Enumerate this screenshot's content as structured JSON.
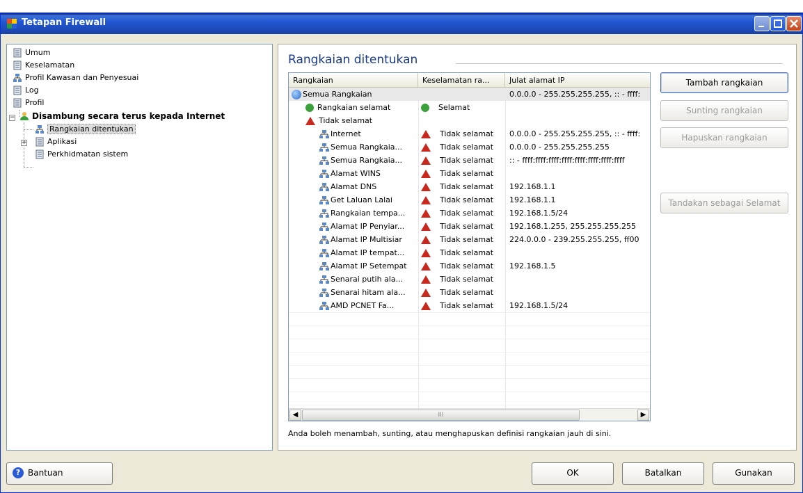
{
  "window": {
    "title": "Tetapan Firewall"
  },
  "tree": {
    "items": [
      {
        "label": "Umum",
        "icon": "document-list-icon"
      },
      {
        "label": "Keselamatan",
        "icon": "document-list-icon"
      },
      {
        "label": "Profil Kawasan dan Penyesuai",
        "icon": "network-icon"
      },
      {
        "label": "Log",
        "icon": "document-list-icon"
      },
      {
        "label": "Profil",
        "icon": "document-list-icon"
      },
      {
        "label": "Disambung secara terus kepada Internet",
        "icon": "user-profile-icon"
      },
      {
        "label": "Rangkaian ditentukan",
        "icon": "network-icon"
      },
      {
        "label": "Aplikasi",
        "icon": "document-list-icon"
      },
      {
        "label": "Perkhidmatan sistem",
        "icon": "document-list-icon"
      }
    ]
  },
  "main": {
    "section_title": "Rangkaian ditentukan",
    "columns": [
      "Rangkaian",
      "Keselamatan ra...",
      "Julat alamat IP"
    ],
    "rows": [
      {
        "name": "Semua Rangkaian",
        "security": "",
        "ip": "0.0.0.0 - 255.255.255.255, :: - ffff:"
      },
      {
        "name": "Rangkaian selamat",
        "security": "Selamat",
        "ip": ""
      },
      {
        "name": "Tidak selamat",
        "security": "",
        "ip": ""
      },
      {
        "name": "Internet",
        "security": "Tidak selamat",
        "ip": "0.0.0.0 - 255.255.255.255, :: - ffff:"
      },
      {
        "name": "Semua Rangkaia...",
        "security": "Tidak selamat",
        "ip": "0.0.0.0 - 255.255.255.255"
      },
      {
        "name": "Semua Rangkaia...",
        "security": "Tidak selamat",
        "ip": ":: - ffff:ffff:ffff:ffff:ffff:ffff:ffff:ffff"
      },
      {
        "name": "Alamat WINS",
        "security": "Tidak selamat",
        "ip": ""
      },
      {
        "name": "Alamat DNS",
        "security": "Tidak selamat",
        "ip": "192.168.1.1"
      },
      {
        "name": "Get Laluan Lalai",
        "security": "Tidak selamat",
        "ip": "192.168.1.1"
      },
      {
        "name": "Rangkaian tempa...",
        "security": "Tidak selamat",
        "ip": "192.168.1.5/24"
      },
      {
        "name": "Alamat IP Penyiar...",
        "security": "Tidak selamat",
        "ip": "192.168.1.255, 255.255.255.255"
      },
      {
        "name": "Alamat IP Multisiar",
        "security": "Tidak selamat",
        "ip": "224.0.0.0 - 239.255.255.255, ff00"
      },
      {
        "name": "Alamat IP tempat...",
        "security": "Tidak selamat",
        "ip": ""
      },
      {
        "name": "Alamat IP Setempat",
        "security": "Tidak selamat",
        "ip": "192.168.1.5"
      },
      {
        "name": "Senarai putih ala...",
        "security": "Tidak selamat",
        "ip": ""
      },
      {
        "name": "Senarai hitam ala...",
        "security": "Tidak selamat",
        "ip": ""
      },
      {
        "name": "AMD PCNET Fa...",
        "security": "Tidak selamat",
        "ip": "192.168.1.5/24"
      }
    ],
    "scroll_grip": "III",
    "footnote": "Anda boleh menambah, sunting, atau menghapuskan definisi rangkaian jauh di sini."
  },
  "actions": {
    "add": "Tambah rangkaian",
    "edit": "Sunting rangkaian",
    "delete": "Hapuskan rangkaian",
    "mark_safe": "Tandakan sebagai Selamat"
  },
  "footer": {
    "help": "Bantuan",
    "ok": "OK",
    "cancel": "Batalkan",
    "apply": "Gunakan"
  },
  "colors": {
    "titlebar": "#2157d4",
    "section_title": "#1a3a8a",
    "warning": "#c8281e",
    "safe": "#3aa13a"
  }
}
